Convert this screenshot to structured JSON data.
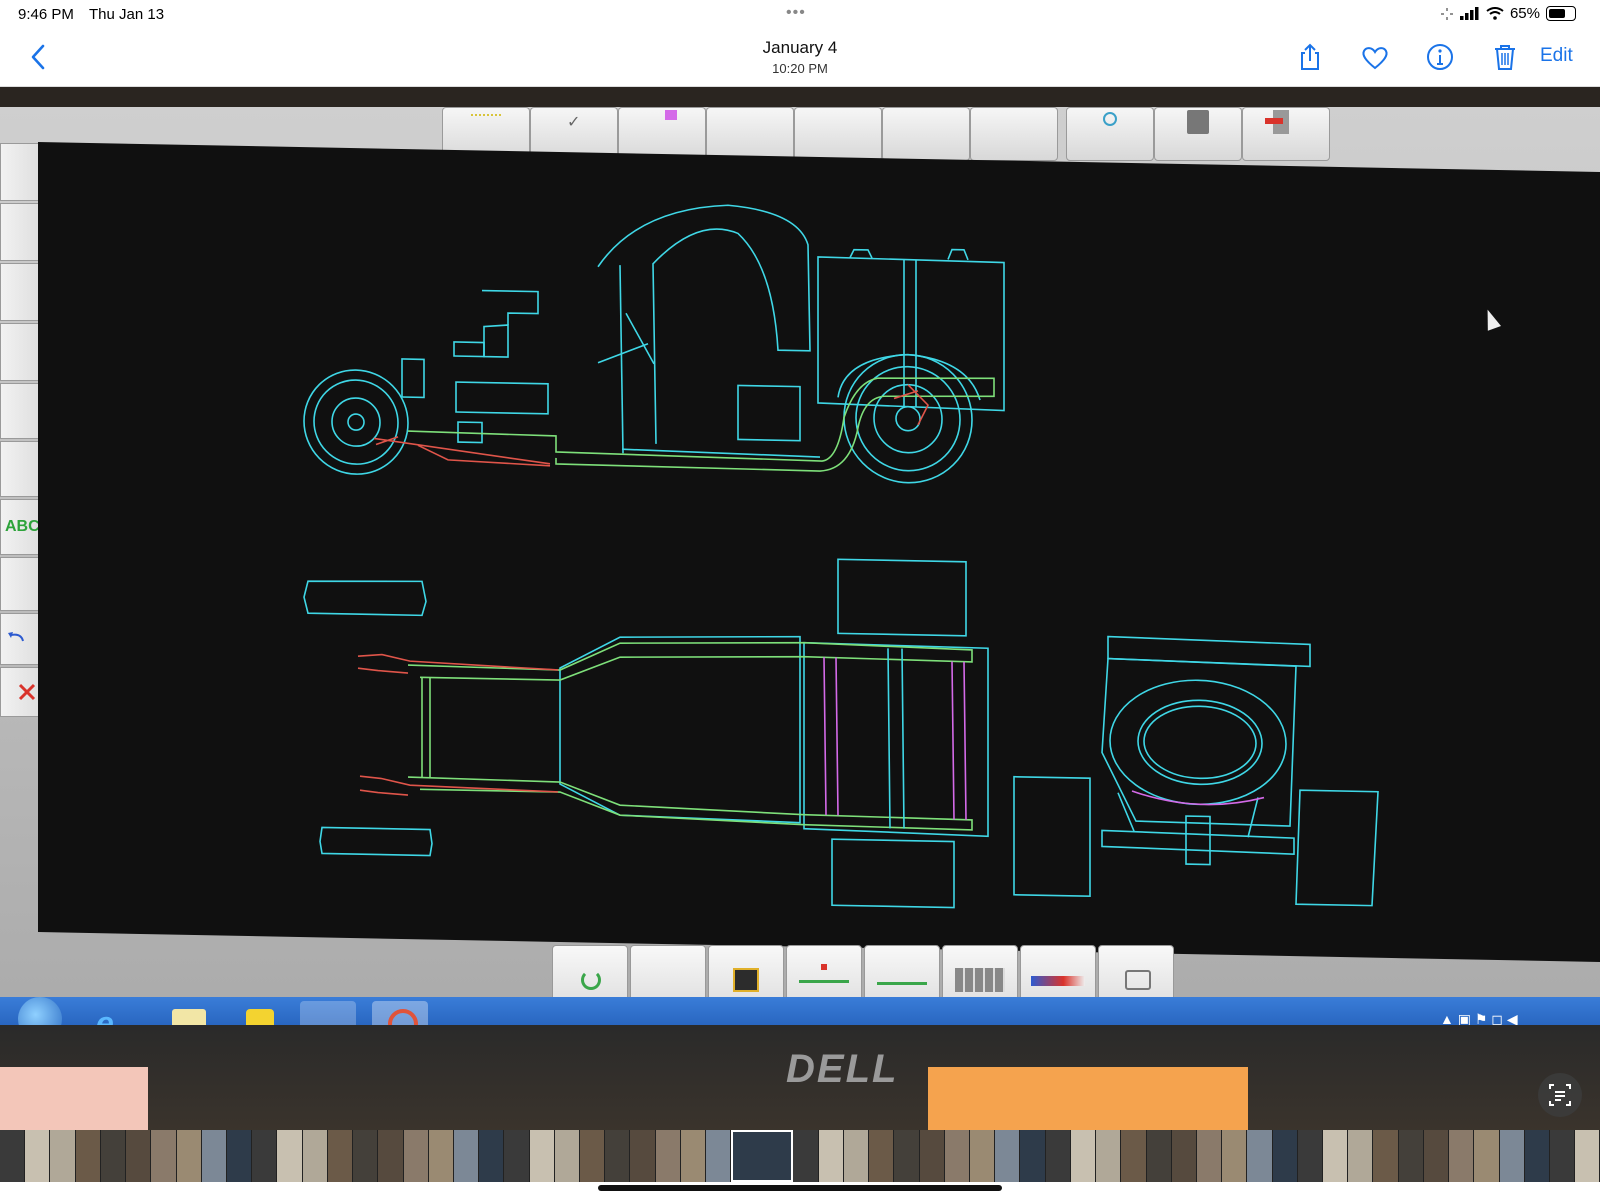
{
  "status_bar": {
    "time": "9:46 PM",
    "date": "Thu Jan 13",
    "battery_percent": "65%",
    "battery_level": 0.65,
    "dots": "•••"
  },
  "nav": {
    "title": "January 4",
    "subtitle": "10:20 PM",
    "edit_label": "Edit",
    "icons": [
      "chevron-left-icon",
      "share-icon",
      "heart-icon",
      "info-icon",
      "trash-icon"
    ],
    "accent_color": "#1a73e8"
  },
  "cad": {
    "side_tools": [
      "",
      "",
      "",
      "",
      "",
      "",
      "",
      "ABC",
      "",
      "",
      ""
    ],
    "colors": {
      "outline": "#3fd7e6",
      "frame": "#7ee07a",
      "suspension": "#e0554a",
      "crossmember": "#d46ae8",
      "background": "#101010"
    }
  },
  "monitor": {
    "brand": "DELL"
  },
  "filmstrip": {
    "count": 62
  }
}
